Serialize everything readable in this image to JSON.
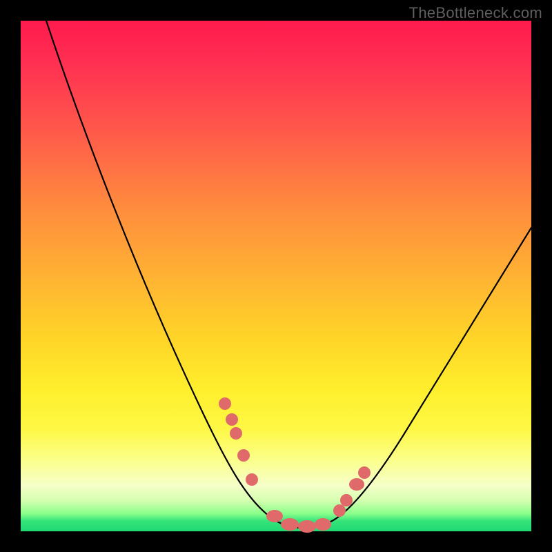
{
  "watermark": "TheBottleneck.com",
  "chart_data": {
    "type": "line",
    "title": "",
    "xlabel": "",
    "ylabel": "",
    "xlim": [
      0,
      100
    ],
    "ylim": [
      0,
      100
    ],
    "grid": false,
    "legend": false,
    "series": [
      {
        "name": "bottleneck-curve",
        "x": [
          5,
          10,
          15,
          20,
          25,
          30,
          35,
          40,
          45,
          47,
          50,
          53,
          55,
          58,
          60,
          65,
          70,
          75,
          80,
          85,
          90,
          95,
          100
        ],
        "y": [
          100,
          90,
          80,
          69,
          58,
          47,
          36,
          25,
          12,
          8,
          3,
          0,
          0,
          0,
          2,
          8,
          16,
          24,
          32,
          40,
          48,
          55,
          62
        ]
      }
    ],
    "markers": {
      "name": "highlight-points",
      "color": "#e06a6a",
      "x": [
        40,
        41,
        42,
        44,
        46,
        50,
        52,
        55,
        58,
        62,
        63,
        65,
        66
      ],
      "y": [
        25,
        22,
        19,
        14,
        9,
        3,
        1,
        0,
        0,
        4,
        6,
        8,
        10
      ]
    },
    "background_gradient": {
      "top": "#ff1a4d",
      "mid": "#ffee2c",
      "bottom": "#20d873"
    }
  }
}
